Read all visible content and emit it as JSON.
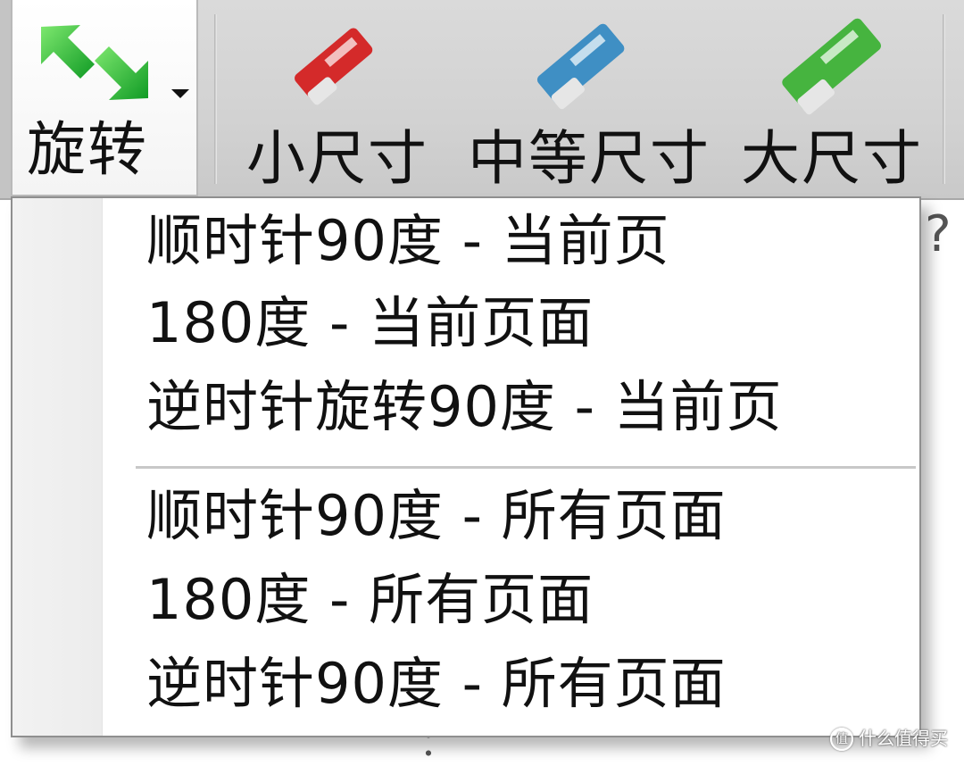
{
  "ribbon": {
    "rotate_label": "旋转",
    "tools": [
      {
        "label": "小尺寸",
        "icon": "eraser-small-icon",
        "color": "#d42a2a"
      },
      {
        "label": "中等尺寸",
        "icon": "eraser-medium-icon",
        "color": "#3f8fc4"
      },
      {
        "label": "大尺寸",
        "icon": "eraser-large-icon",
        "color": "#46b43f"
      }
    ]
  },
  "menu": {
    "items": [
      {
        "label": "顺时针90度 - 当前页"
      },
      {
        "label": "180度 - 当前页面"
      },
      {
        "label": "逆时针旋转90度 - 当前页"
      },
      {
        "label": "顺时针90度 - 所有页面"
      },
      {
        "label": "180度 - 所有页面"
      },
      {
        "label": "逆时针90度 - 所有页面"
      }
    ]
  },
  "background": {
    "visible_chars": [
      "?",
      "："
    ]
  },
  "watermark": {
    "text": "什么值得买",
    "logo": "值"
  },
  "colors": {
    "accent_green": "#3cc43c",
    "menu_border": "#8f8f8f"
  }
}
